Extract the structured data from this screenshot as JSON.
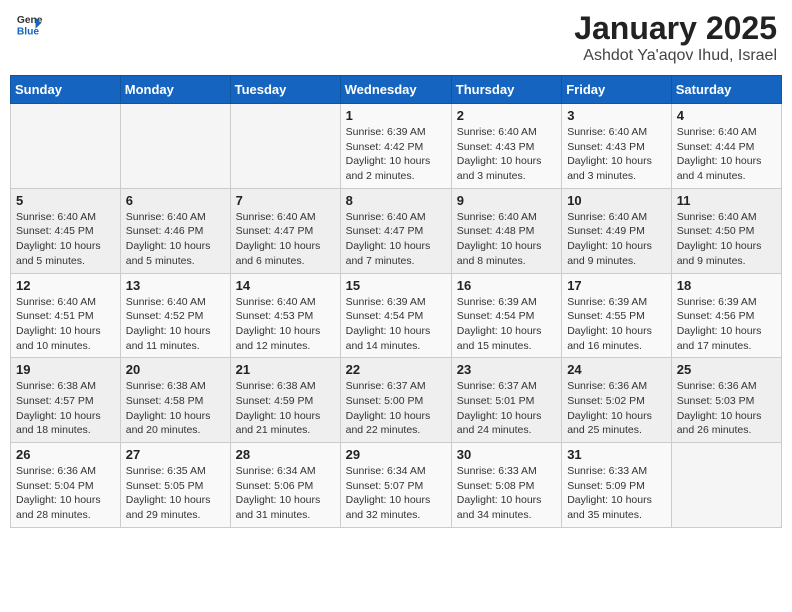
{
  "header": {
    "logo_line1": "General",
    "logo_line2": "Blue",
    "title": "January 2025",
    "subtitle": "Ashdot Ya'aqov Ihud, Israel"
  },
  "weekdays": [
    "Sunday",
    "Monday",
    "Tuesday",
    "Wednesday",
    "Thursday",
    "Friday",
    "Saturday"
  ],
  "weeks": [
    [
      {
        "day": "",
        "info": ""
      },
      {
        "day": "",
        "info": ""
      },
      {
        "day": "",
        "info": ""
      },
      {
        "day": "1",
        "info": "Sunrise: 6:39 AM\nSunset: 4:42 PM\nDaylight: 10 hours\nand 2 minutes."
      },
      {
        "day": "2",
        "info": "Sunrise: 6:40 AM\nSunset: 4:43 PM\nDaylight: 10 hours\nand 3 minutes."
      },
      {
        "day": "3",
        "info": "Sunrise: 6:40 AM\nSunset: 4:43 PM\nDaylight: 10 hours\nand 3 minutes."
      },
      {
        "day": "4",
        "info": "Sunrise: 6:40 AM\nSunset: 4:44 PM\nDaylight: 10 hours\nand 4 minutes."
      }
    ],
    [
      {
        "day": "5",
        "info": "Sunrise: 6:40 AM\nSunset: 4:45 PM\nDaylight: 10 hours\nand 5 minutes."
      },
      {
        "day": "6",
        "info": "Sunrise: 6:40 AM\nSunset: 4:46 PM\nDaylight: 10 hours\nand 5 minutes."
      },
      {
        "day": "7",
        "info": "Sunrise: 6:40 AM\nSunset: 4:47 PM\nDaylight: 10 hours\nand 6 minutes."
      },
      {
        "day": "8",
        "info": "Sunrise: 6:40 AM\nSunset: 4:47 PM\nDaylight: 10 hours\nand 7 minutes."
      },
      {
        "day": "9",
        "info": "Sunrise: 6:40 AM\nSunset: 4:48 PM\nDaylight: 10 hours\nand 8 minutes."
      },
      {
        "day": "10",
        "info": "Sunrise: 6:40 AM\nSunset: 4:49 PM\nDaylight: 10 hours\nand 9 minutes."
      },
      {
        "day": "11",
        "info": "Sunrise: 6:40 AM\nSunset: 4:50 PM\nDaylight: 10 hours\nand 9 minutes."
      }
    ],
    [
      {
        "day": "12",
        "info": "Sunrise: 6:40 AM\nSunset: 4:51 PM\nDaylight: 10 hours\nand 10 minutes."
      },
      {
        "day": "13",
        "info": "Sunrise: 6:40 AM\nSunset: 4:52 PM\nDaylight: 10 hours\nand 11 minutes."
      },
      {
        "day": "14",
        "info": "Sunrise: 6:40 AM\nSunset: 4:53 PM\nDaylight: 10 hours\nand 12 minutes."
      },
      {
        "day": "15",
        "info": "Sunrise: 6:39 AM\nSunset: 4:54 PM\nDaylight: 10 hours\nand 14 minutes."
      },
      {
        "day": "16",
        "info": "Sunrise: 6:39 AM\nSunset: 4:54 PM\nDaylight: 10 hours\nand 15 minutes."
      },
      {
        "day": "17",
        "info": "Sunrise: 6:39 AM\nSunset: 4:55 PM\nDaylight: 10 hours\nand 16 minutes."
      },
      {
        "day": "18",
        "info": "Sunrise: 6:39 AM\nSunset: 4:56 PM\nDaylight: 10 hours\nand 17 minutes."
      }
    ],
    [
      {
        "day": "19",
        "info": "Sunrise: 6:38 AM\nSunset: 4:57 PM\nDaylight: 10 hours\nand 18 minutes."
      },
      {
        "day": "20",
        "info": "Sunrise: 6:38 AM\nSunset: 4:58 PM\nDaylight: 10 hours\nand 20 minutes."
      },
      {
        "day": "21",
        "info": "Sunrise: 6:38 AM\nSunset: 4:59 PM\nDaylight: 10 hours\nand 21 minutes."
      },
      {
        "day": "22",
        "info": "Sunrise: 6:37 AM\nSunset: 5:00 PM\nDaylight: 10 hours\nand 22 minutes."
      },
      {
        "day": "23",
        "info": "Sunrise: 6:37 AM\nSunset: 5:01 PM\nDaylight: 10 hours\nand 24 minutes."
      },
      {
        "day": "24",
        "info": "Sunrise: 6:36 AM\nSunset: 5:02 PM\nDaylight: 10 hours\nand 25 minutes."
      },
      {
        "day": "25",
        "info": "Sunrise: 6:36 AM\nSunset: 5:03 PM\nDaylight: 10 hours\nand 26 minutes."
      }
    ],
    [
      {
        "day": "26",
        "info": "Sunrise: 6:36 AM\nSunset: 5:04 PM\nDaylight: 10 hours\nand 28 minutes."
      },
      {
        "day": "27",
        "info": "Sunrise: 6:35 AM\nSunset: 5:05 PM\nDaylight: 10 hours\nand 29 minutes."
      },
      {
        "day": "28",
        "info": "Sunrise: 6:34 AM\nSunset: 5:06 PM\nDaylight: 10 hours\nand 31 minutes."
      },
      {
        "day": "29",
        "info": "Sunrise: 6:34 AM\nSunset: 5:07 PM\nDaylight: 10 hours\nand 32 minutes."
      },
      {
        "day": "30",
        "info": "Sunrise: 6:33 AM\nSunset: 5:08 PM\nDaylight: 10 hours\nand 34 minutes."
      },
      {
        "day": "31",
        "info": "Sunrise: 6:33 AM\nSunset: 5:09 PM\nDaylight: 10 hours\nand 35 minutes."
      },
      {
        "day": "",
        "info": ""
      }
    ]
  ]
}
